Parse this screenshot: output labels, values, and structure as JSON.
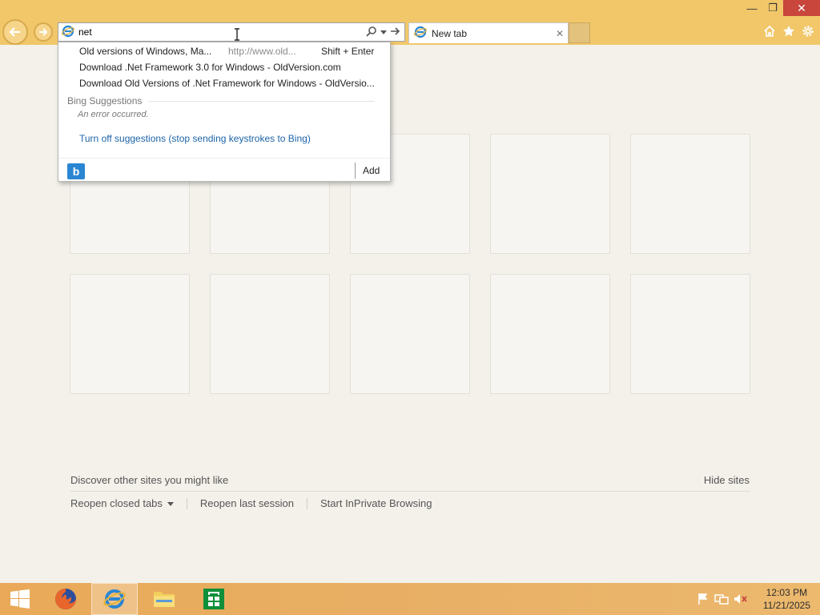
{
  "window": {
    "minimize_glyph": "—",
    "restore_glyph": "❐",
    "close_glyph": "✕"
  },
  "address_bar": {
    "value": "net",
    "icon": "ie-icon"
  },
  "tab": {
    "label": "New tab",
    "close_glyph": "✕"
  },
  "dropdown": {
    "history": [
      {
        "title": "Old versions of Windows, Ma...",
        "url": "http://www.old...",
        "hint": "Shift + Enter"
      },
      {
        "title": "Download .Net Framework 3.0 for Windows - OldVersion.com"
      },
      {
        "title": "Download Old Versions of .Net Framework for Windows - OldVersio..."
      }
    ],
    "section_title": "Bing Suggestions",
    "error": "An error occurred.",
    "turn_off": "Turn off suggestions (stop sending keystrokes to Bing)",
    "provider_glyph": "b",
    "add_label": "Add"
  },
  "footer": {
    "discover": "Discover other sites you might like",
    "hide_sites": "Hide sites",
    "reopen_closed": "Reopen closed tabs",
    "reopen_last": "Reopen last session",
    "inprivate": "Start InPrivate Browsing"
  },
  "taskbar": {
    "time": "12:03 PM",
    "date": "11/21/2025"
  },
  "colors": {
    "frame": "#f1c76a",
    "link": "#1d64a8",
    "bing": "#2a86d3",
    "close": "#c9463d"
  }
}
